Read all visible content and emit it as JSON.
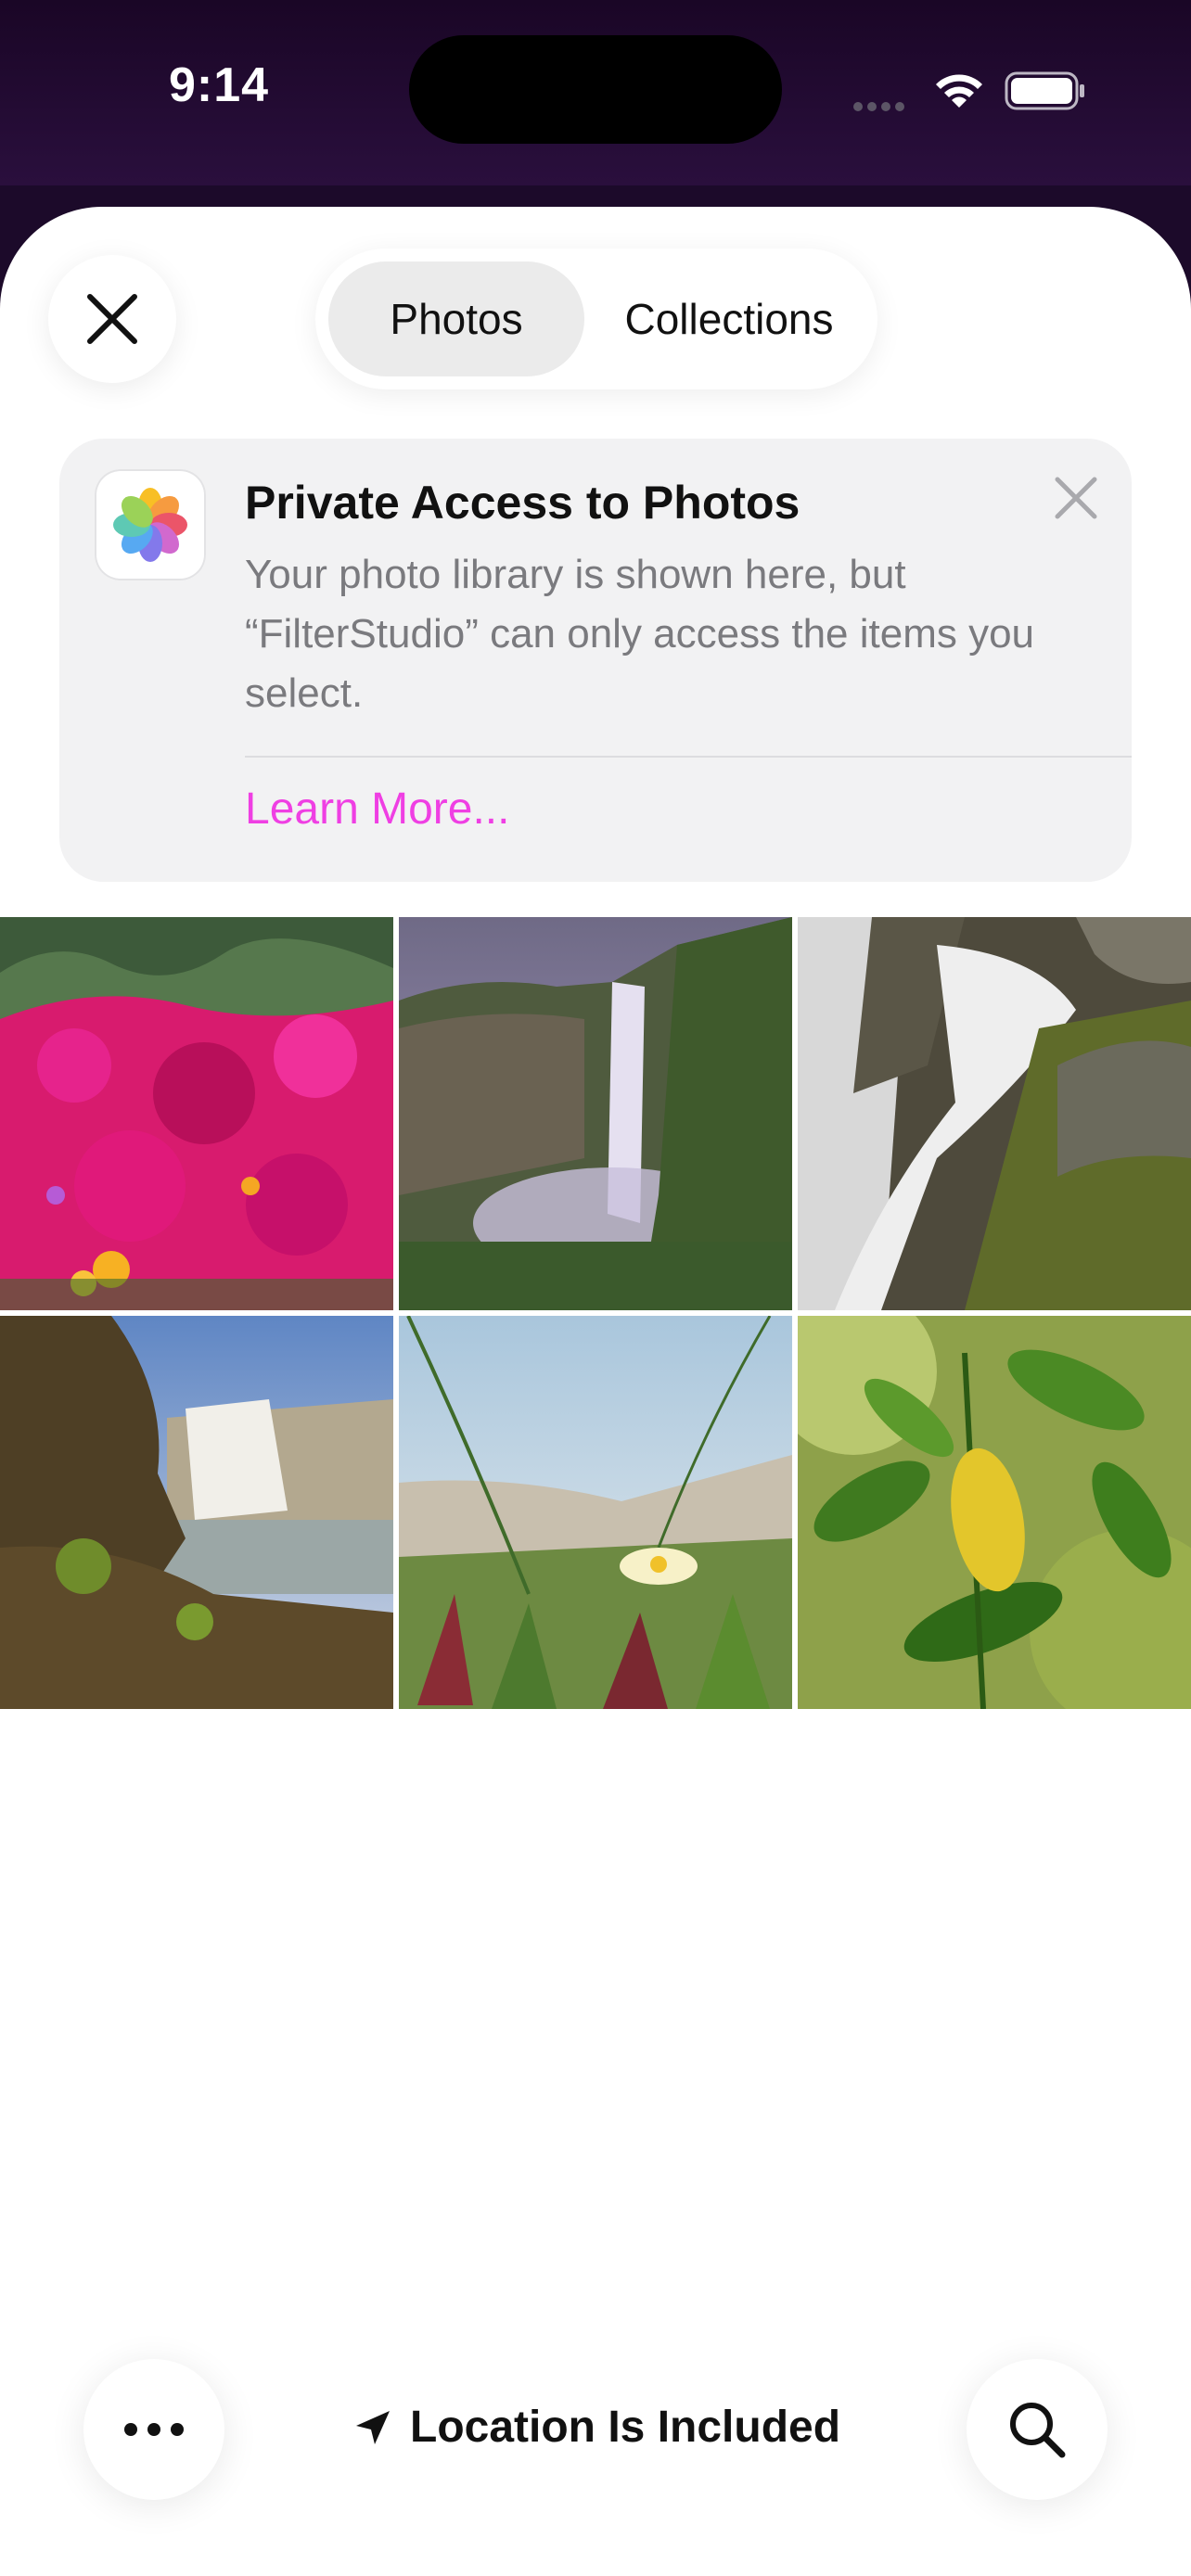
{
  "status_bar": {
    "time": "9:14"
  },
  "tabs": [
    {
      "label": "Photos",
      "selected": true
    },
    {
      "label": "Collections",
      "selected": false
    }
  ],
  "banner": {
    "title": "Private Access to Photos",
    "body": "Your photo library is shown here, but “FilterStudio” can only access the items you select.",
    "link": "Learn More..."
  },
  "photos": [
    {
      "subject": "pink-flowers"
    },
    {
      "subject": "waterfall-cliff"
    },
    {
      "subject": "waterfall-rocks"
    },
    {
      "subject": "waterfall-shore"
    },
    {
      "subject": "beach-grass-flower"
    },
    {
      "subject": "green-leaves"
    }
  ],
  "toolbar": {
    "location_label": "Location Is Included",
    "more_icon": "ellipsis-icon",
    "search_icon": "magnifier-icon",
    "location_icon": "location-arrow-icon"
  },
  "colors": {
    "accent": "#ef3fe3",
    "status_bg": "#1c0a2a"
  }
}
